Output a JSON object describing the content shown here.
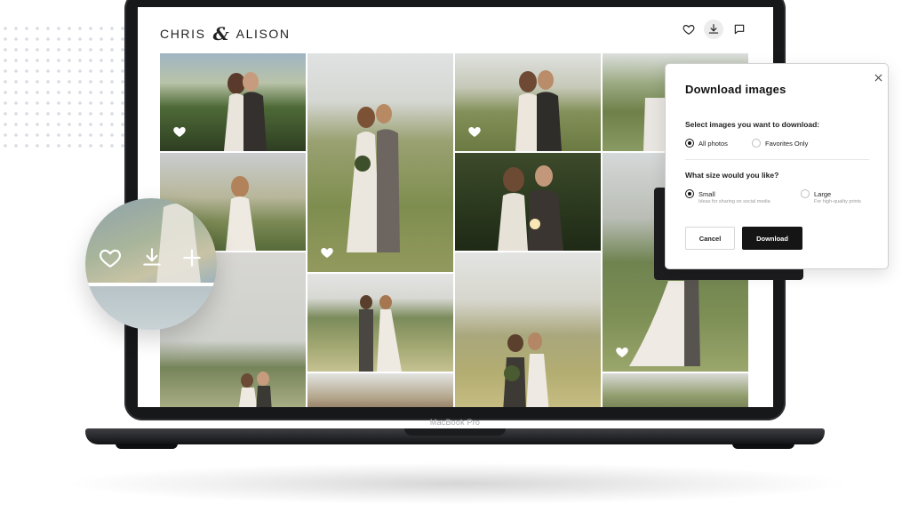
{
  "device": {
    "label": "MacBook Pro"
  },
  "gallery": {
    "title_left": "CHRIS",
    "title_amp": "&",
    "title_right": "ALISON",
    "header_icons": [
      "heart-icon",
      "download-icon",
      "comment-icon"
    ],
    "photos": [
      {
        "id": "p1",
        "favorite": true
      },
      {
        "id": "p2",
        "favorite": false
      },
      {
        "id": "p3",
        "favorite": false
      },
      {
        "id": "p4",
        "favorite": true
      },
      {
        "id": "p5",
        "favorite": false
      },
      {
        "id": "p6",
        "favorite": true
      },
      {
        "id": "p7",
        "favorite": false
      },
      {
        "id": "p8",
        "favorite": false
      },
      {
        "id": "p9",
        "favorite": false
      },
      {
        "id": "p10",
        "favorite": false
      },
      {
        "id": "p11",
        "favorite": true
      },
      {
        "id": "p12",
        "favorite": false
      },
      {
        "id": "p13",
        "favorite": false
      },
      {
        "id": "p14",
        "favorite": false
      }
    ]
  },
  "magnifier": {
    "icons": [
      "heart-icon",
      "download-icon",
      "plus-icon"
    ]
  },
  "modal": {
    "title": "Download images",
    "question_images": "Select images you want to download:",
    "option_all": "All photos",
    "option_favorites": "Favorites Only",
    "question_size": "What size would you like?",
    "option_small": "Small",
    "option_small_desc": "Ideas for sharing on social media",
    "option_large": "Large",
    "option_large_desc": "For high-quality prints",
    "cancel_label": "Cancel",
    "download_label": "Download",
    "selected_images": "All photos",
    "selected_size": "Small"
  }
}
